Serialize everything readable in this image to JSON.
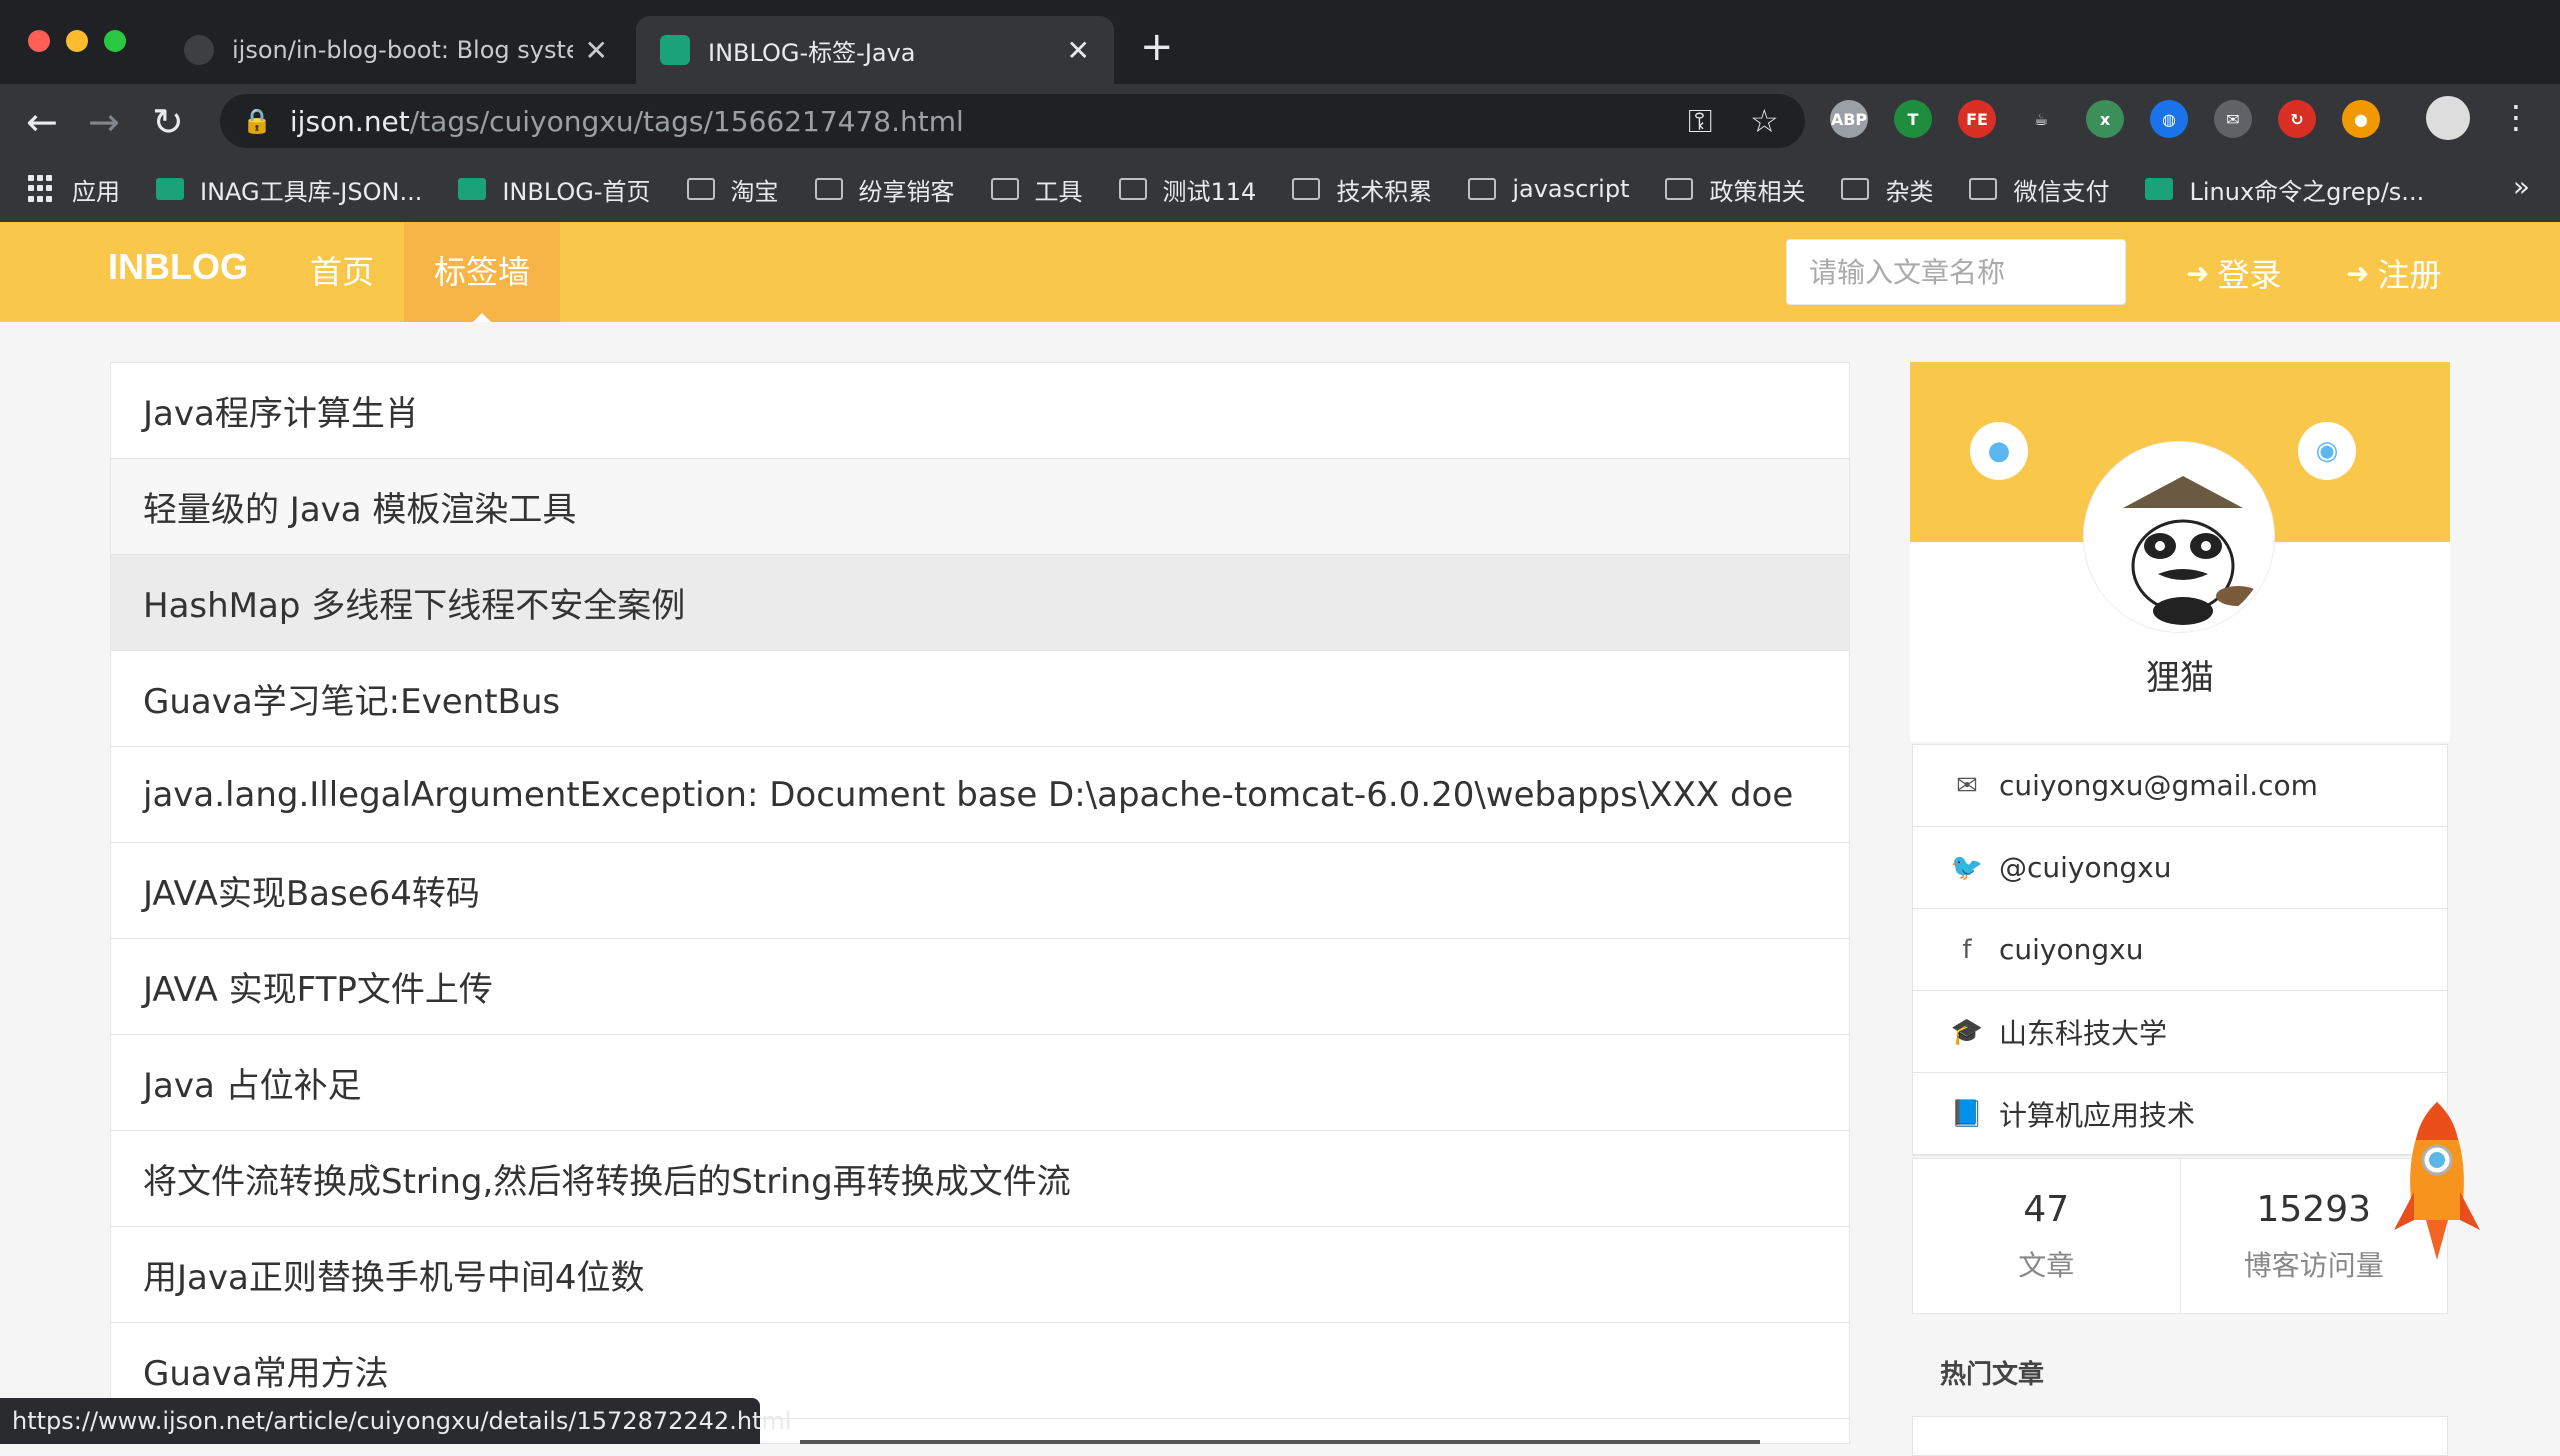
{
  "browser": {
    "tabs": [
      {
        "title": "ijson/in-blog-boot: Blog system",
        "close": "✕"
      },
      {
        "title": "INBLOG-标签-Java",
        "close": "✕"
      }
    ],
    "new_tab": "+",
    "url_host": "ijson.net",
    "url_path": "/tags/cuiyongxu/tags/1566217478.html",
    "bookmarks": [
      {
        "label": "应用",
        "type": "apps"
      },
      {
        "label": "INAG工具库-JSON...",
        "type": "site"
      },
      {
        "label": "INBLOG-首页",
        "type": "site"
      },
      {
        "label": "淘宝",
        "type": "folder"
      },
      {
        "label": "纷享销客",
        "type": "folder"
      },
      {
        "label": "工具",
        "type": "folder"
      },
      {
        "label": "测试114",
        "type": "folder"
      },
      {
        "label": "技术积累",
        "type": "folder"
      },
      {
        "label": "javascript",
        "type": "folder"
      },
      {
        "label": "政策相关",
        "type": "folder"
      },
      {
        "label": "杂类",
        "type": "folder"
      },
      {
        "label": "微信支付",
        "type": "folder"
      },
      {
        "label": "Linux命令之grep/s...",
        "type": "site"
      }
    ],
    "bookmarks_more": "»",
    "extensions": [
      {
        "name": "abp",
        "text": "ABP",
        "color": "#9aa0a6"
      },
      {
        "name": "t",
        "text": "T",
        "color": "#1e8e3e"
      },
      {
        "name": "fe",
        "text": "FE",
        "color": "#d93025"
      },
      {
        "name": "java",
        "text": "☕",
        "color": "#35363a"
      },
      {
        "name": "ext5",
        "text": "x",
        "color": "#3c8e5a"
      },
      {
        "name": "globe",
        "text": "◍",
        "color": "#1a73e8"
      },
      {
        "name": "mail",
        "text": "✉",
        "color": "#5f6368"
      },
      {
        "name": "sync",
        "text": "↻",
        "color": "#d93025"
      },
      {
        "name": "ball",
        "text": "●",
        "color": "#f29900"
      }
    ],
    "status_url": "https://www.ijson.net/article/cuiyongxu/details/1572872242.html"
  },
  "site": {
    "brand": "INBLOG",
    "nav": [
      {
        "label": "首页",
        "active": false
      },
      {
        "label": "标签墙",
        "active": true
      }
    ],
    "search_placeholder": "请输入文章名称",
    "login": "登录",
    "register": "注册"
  },
  "articles": [
    "Java程序计算生肖",
    "轻量级的 Java 模板渲染工具",
    "HashMap 多线程下线程不安全案例",
    "Guava学习笔记:EventBus",
    "java.lang.IllegalArgumentException: Document base D:\\apache-tomcat-6.0.20\\webapps\\XXX doe",
    "JAVA实现Base64转码",
    "JAVA 实现FTP文件上传",
    "Java 占位补足",
    "将文件流转换成String,然后将转换后的String再转换成文件流",
    "用Java正则替换手机号中间4位数",
    "Guava常用方法"
  ],
  "profile": {
    "name": "狸猫",
    "info": [
      {
        "icon": "envelope-icon",
        "glyph": "✉",
        "text": "cuiyongxu@gmail.com"
      },
      {
        "icon": "twitter-icon",
        "glyph": "🐦",
        "text": "@cuiyongxu"
      },
      {
        "icon": "facebook-icon",
        "glyph": "f",
        "text": "cuiyongxu"
      },
      {
        "icon": "graduation-cap-icon",
        "glyph": "🎓",
        "text": "山东科技大学"
      },
      {
        "icon": "book-icon",
        "glyph": "📘",
        "text": "计算机应用技术"
      }
    ],
    "stats": [
      {
        "value": "47",
        "label": "文章"
      },
      {
        "value": "15293",
        "label": "博客访问量"
      }
    ]
  },
  "hot_title": "热门文章"
}
